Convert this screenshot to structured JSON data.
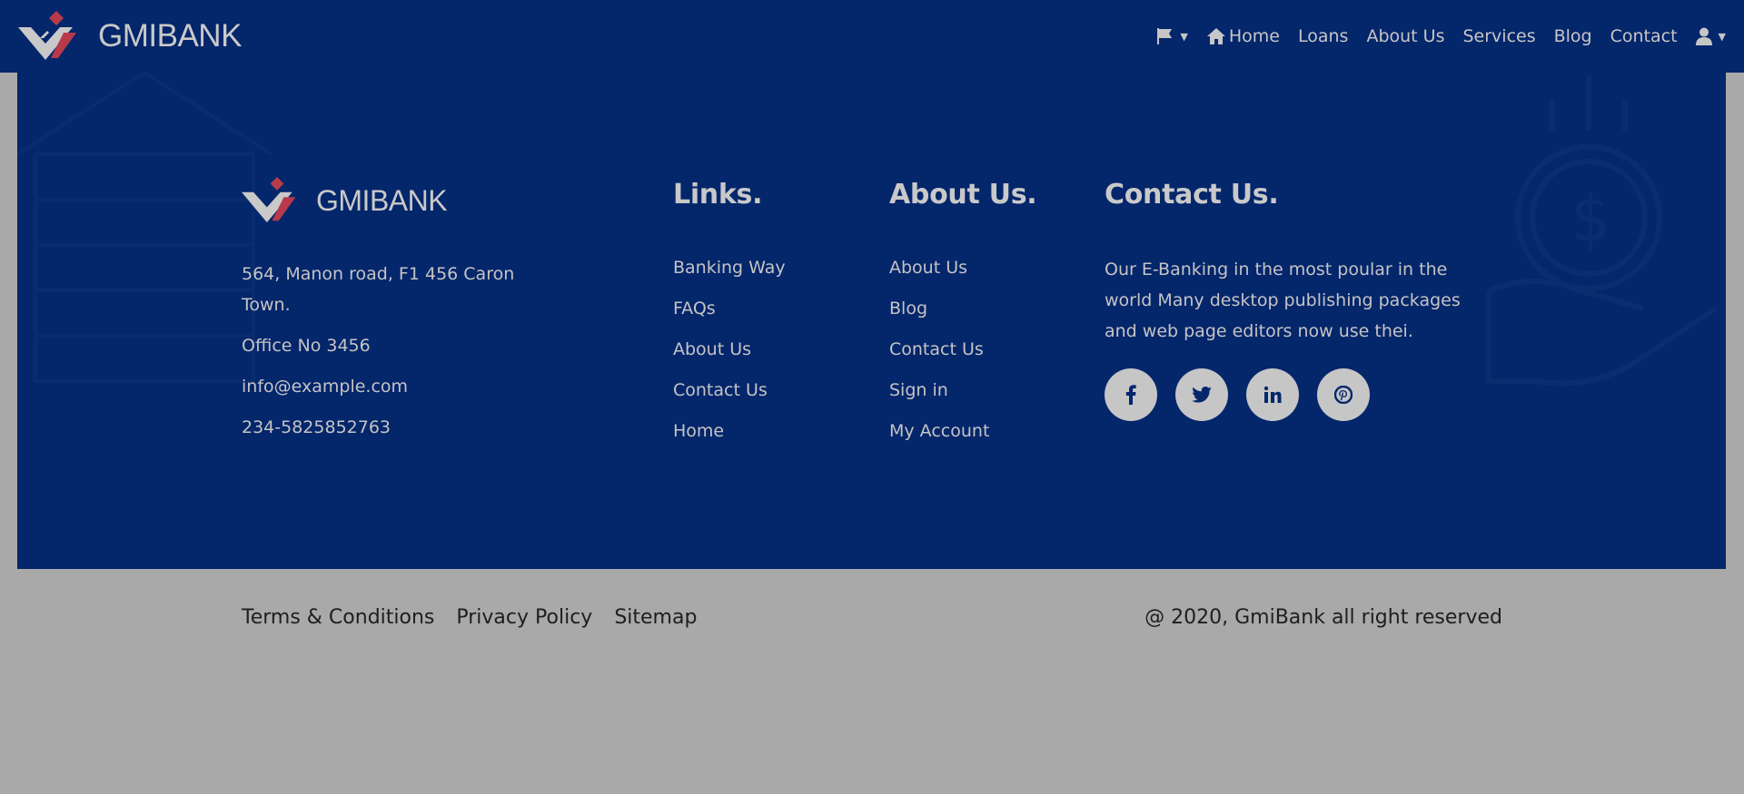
{
  "brand": {
    "name": "GMIBANK"
  },
  "navbar": {
    "items": [
      {
        "label": "Home",
        "icon": "home-icon"
      },
      {
        "label": "Loans"
      },
      {
        "label": "About Us"
      },
      {
        "label": "Services"
      },
      {
        "label": "Blog"
      },
      {
        "label": "Contact"
      }
    ]
  },
  "footer": {
    "address": {
      "street": "564, Manon road, F1 456 Caron Town.",
      "office": "Office No 3456",
      "email": "info@example.com",
      "phone": "234-5825852763"
    },
    "links": {
      "title": "Links.",
      "items": [
        "Banking Way",
        "FAQs",
        "About Us",
        "Contact Us",
        "Home"
      ]
    },
    "about": {
      "title": "About Us.",
      "items": [
        "About Us",
        "Blog",
        "Contact Us",
        "Sign in",
        "My Account"
      ]
    },
    "contact": {
      "title": "Contact Us.",
      "text": "Our E-Banking in the most poular in the world Many desktop publishing packages and web page editors now use thei."
    },
    "social": [
      "facebook-icon",
      "twitter-icon",
      "linkedin-icon",
      "pinterest-icon"
    ]
  },
  "bottom": {
    "links": [
      "Terms & Conditions",
      "Privacy Policy",
      "Sitemap"
    ],
    "copyright": "@ 2020, GmiBank all right reserved"
  },
  "colors": {
    "navy": "#04266b",
    "overlay_gray": "#a9a9a9",
    "logo_red": "#c0392b"
  }
}
